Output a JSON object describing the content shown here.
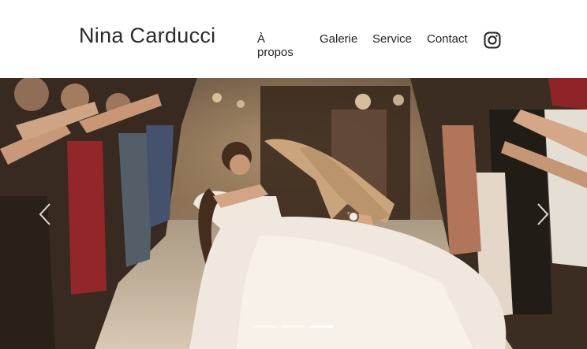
{
  "header": {
    "brand": "Nina Carducci",
    "nav": [
      {
        "label": "À propos"
      },
      {
        "label": "Galerie"
      },
      {
        "label": "Service"
      },
      {
        "label": "Contact"
      }
    ],
    "social_icon": "instagram-icon"
  },
  "carousel": {
    "slide_count": 3,
    "active_index": 2,
    "prev_icon": "chevron-left-icon",
    "next_icon": "chevron-right-icon",
    "indicator_color": "#ffffff",
    "indicator_inactive_opacity": 0.5
  }
}
